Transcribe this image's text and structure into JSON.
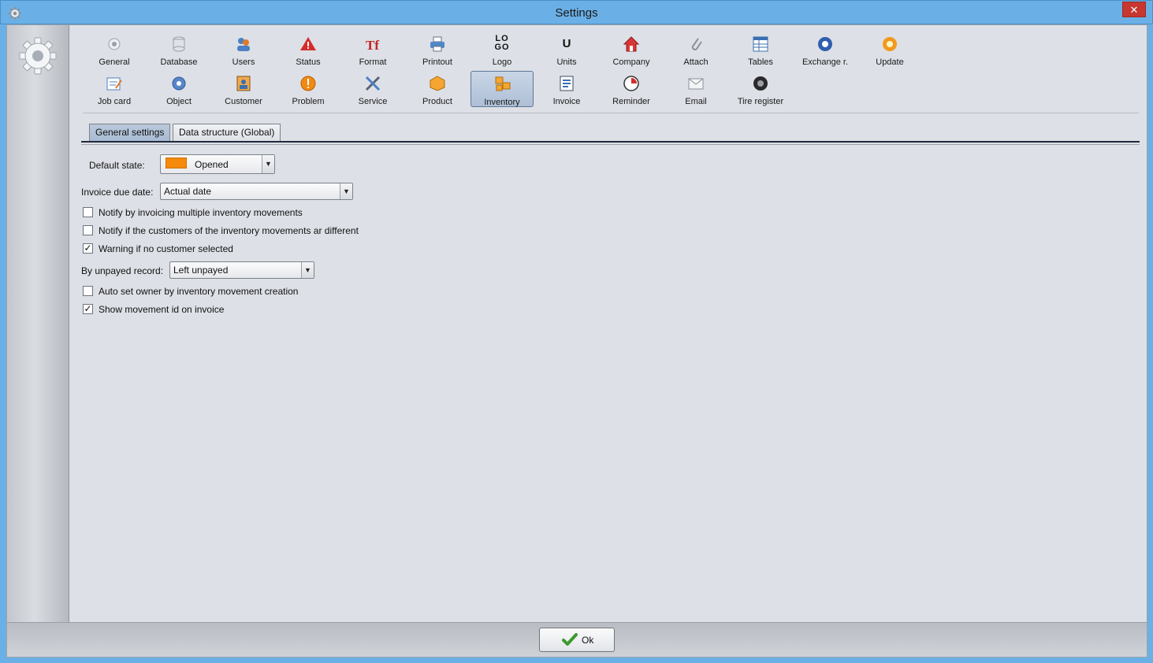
{
  "window": {
    "title": "Settings",
    "close_glyph": "✕"
  },
  "toolbar": {
    "row1": [
      {
        "label": "General",
        "icon": "gear-icon"
      },
      {
        "label": "Database",
        "icon": "database-icon"
      },
      {
        "label": "Users",
        "icon": "users-icon"
      },
      {
        "label": "Status",
        "icon": "warning-icon"
      },
      {
        "label": "Format",
        "icon": "format-icon"
      },
      {
        "label": "Printout",
        "icon": "printer-icon"
      },
      {
        "label": "Logo",
        "icon": "logo-icon"
      },
      {
        "label": "Units",
        "icon": "units-icon"
      },
      {
        "label": "Company",
        "icon": "house-icon"
      },
      {
        "label": "Attach",
        "icon": "paperclip-icon"
      },
      {
        "label": "Tables",
        "icon": "table-icon"
      },
      {
        "label": "Exchange r.",
        "icon": "exchange-icon"
      },
      {
        "label": "Update",
        "icon": "update-icon"
      }
    ],
    "row2": [
      {
        "label": "Job card",
        "icon": "jobcard-icon"
      },
      {
        "label": "Object",
        "icon": "object-gear-icon"
      },
      {
        "label": "Customer",
        "icon": "customer-icon"
      },
      {
        "label": "Problem",
        "icon": "problem-icon"
      },
      {
        "label": "Service",
        "icon": "tools-icon"
      },
      {
        "label": "Product",
        "icon": "box-icon"
      },
      {
        "label": "Inventory",
        "icon": "boxes-icon"
      },
      {
        "label": "Invoice",
        "icon": "invoice-icon"
      },
      {
        "label": "Reminder",
        "icon": "reminder-icon"
      },
      {
        "label": "Email",
        "icon": "email-icon"
      },
      {
        "label": "Tire register",
        "icon": "tire-icon"
      }
    ],
    "logo_glyph": "LO GO",
    "units_glyph": "U"
  },
  "tabs": [
    {
      "label": "General settings",
      "active": true
    },
    {
      "label": "Data structure (Global)",
      "active": false
    }
  ],
  "form": {
    "default_state_label": "Default state:",
    "default_state_value": "Opened",
    "default_state_color": "#f58a0c",
    "invoice_due_label": "Invoice due date:",
    "invoice_due_value": "Actual date",
    "unpayed_label": "By unpayed record:",
    "unpayed_value": "Left unpayed",
    "checks": [
      {
        "label": "Notify by invoicing multiple inventory movements",
        "checked": false
      },
      {
        "label": "Notify if the customers of the inventory movements ar different",
        "checked": false
      },
      {
        "label": "Warning if no customer selected",
        "checked": true
      },
      {
        "label": "Auto set owner by inventory movement creation",
        "checked": false
      },
      {
        "label": "Show movement id on invoice",
        "checked": true
      }
    ],
    "checked_glyph": "✓",
    "arrow_glyph": "▼"
  },
  "footer": {
    "ok_label": "Ok"
  }
}
